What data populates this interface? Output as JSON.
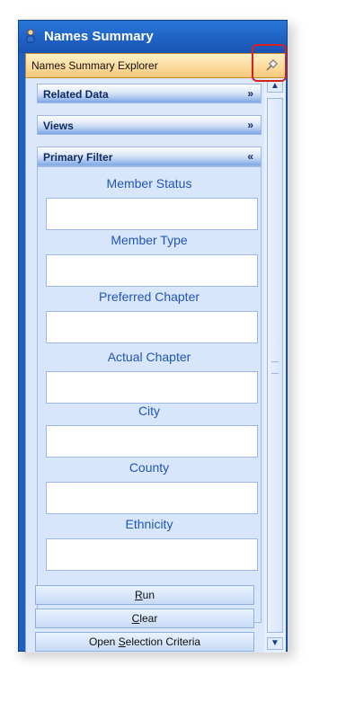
{
  "window": {
    "title": "Names Summary"
  },
  "explorer": {
    "label": "Names Summary Explorer"
  },
  "sections": [
    {
      "label": "Related Data",
      "chevron": "double-chevron-down"
    },
    {
      "label": "Views",
      "chevron": "double-chevron-down"
    },
    {
      "label": "Primary Filter",
      "chevron": "double-chevron-up"
    }
  ],
  "filters": [
    {
      "label": "Member Status",
      "value": ""
    },
    {
      "label": "Member Type",
      "value": ""
    },
    {
      "label": "Preferred Chapter",
      "value": ""
    },
    {
      "label": "Actual Chapter",
      "value": ""
    },
    {
      "label": "City",
      "value": ""
    },
    {
      "label": "County",
      "value": ""
    },
    {
      "label": "Ethnicity",
      "value": ""
    }
  ],
  "buttons": {
    "run": {
      "mnemonic": "R",
      "rest": "un"
    },
    "clear": {
      "mnemonic": "C",
      "rest": "lear"
    },
    "open_selection": {
      "pre": "Open ",
      "mnemonic": "S",
      "rest": "election Criteria"
    }
  },
  "colors": {
    "accent": "#2155b7",
    "highlight": "#d72020",
    "explorer_bg": "#f8c879"
  },
  "icons": [
    "person-icon",
    "pin-icon",
    "double-chevron-down-icon",
    "double-chevron-up-icon",
    "scroll-up-icon",
    "scroll-down-icon"
  ]
}
